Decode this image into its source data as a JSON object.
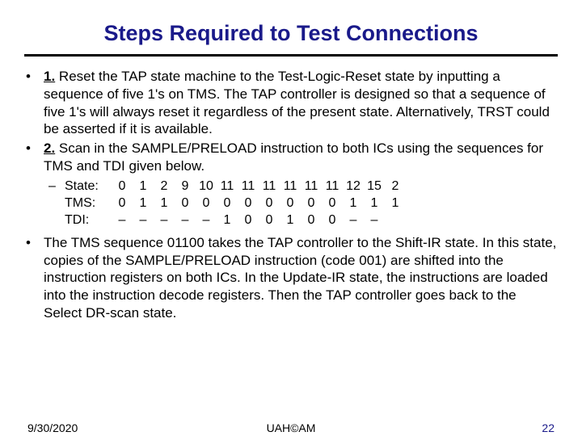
{
  "title": "Steps Required to Test Connections",
  "bullets": {
    "b1_num": "1.",
    "b1_text": " Reset the TAP state machine to the Test-Logic-Reset state by inputting a sequence of five 1's on TMS. The TAP controller is designed so that a sequence of five 1's will always reset it regardless of the present state. Alternatively, TRST could be asserted if it is available.",
    "b2_num": "2.",
    "b2_text": " Scan in the SAMPLE/PRELOAD instruction to both ICs using the sequences for TMS and TDI given below.",
    "b3_text": "The TMS sequence 01100 takes the TAP controller to the Shift-IR state. In this state, copies of the SAMPLE/PRELOAD instruction (code 001) are shifted into the instruction registers on both ICs. In the Update-IR state, the instructions are loaded into the instruction decode registers. Then the TAP controller goes back to the Select DR-scan state."
  },
  "seq": {
    "labels": {
      "state": "State:",
      "tms": "TMS:",
      "tdi": "TDI:"
    },
    "state": [
      "0",
      "1",
      "2",
      "9",
      "10",
      "11",
      "11",
      "11",
      "11",
      "11",
      "11",
      "12",
      "15",
      "2"
    ],
    "tms": [
      "0",
      "1",
      "1",
      "0",
      "0",
      "0",
      "0",
      "0",
      "0",
      "0",
      "0",
      "1",
      "1",
      "1"
    ],
    "tdi": [
      "–",
      "–",
      "–",
      "–",
      "–",
      "1",
      "0",
      "0",
      "1",
      "0",
      "0",
      "–",
      "–",
      ""
    ]
  },
  "footer": {
    "date": "9/30/2020",
    "center": "UAH©AM",
    "page": "22"
  }
}
